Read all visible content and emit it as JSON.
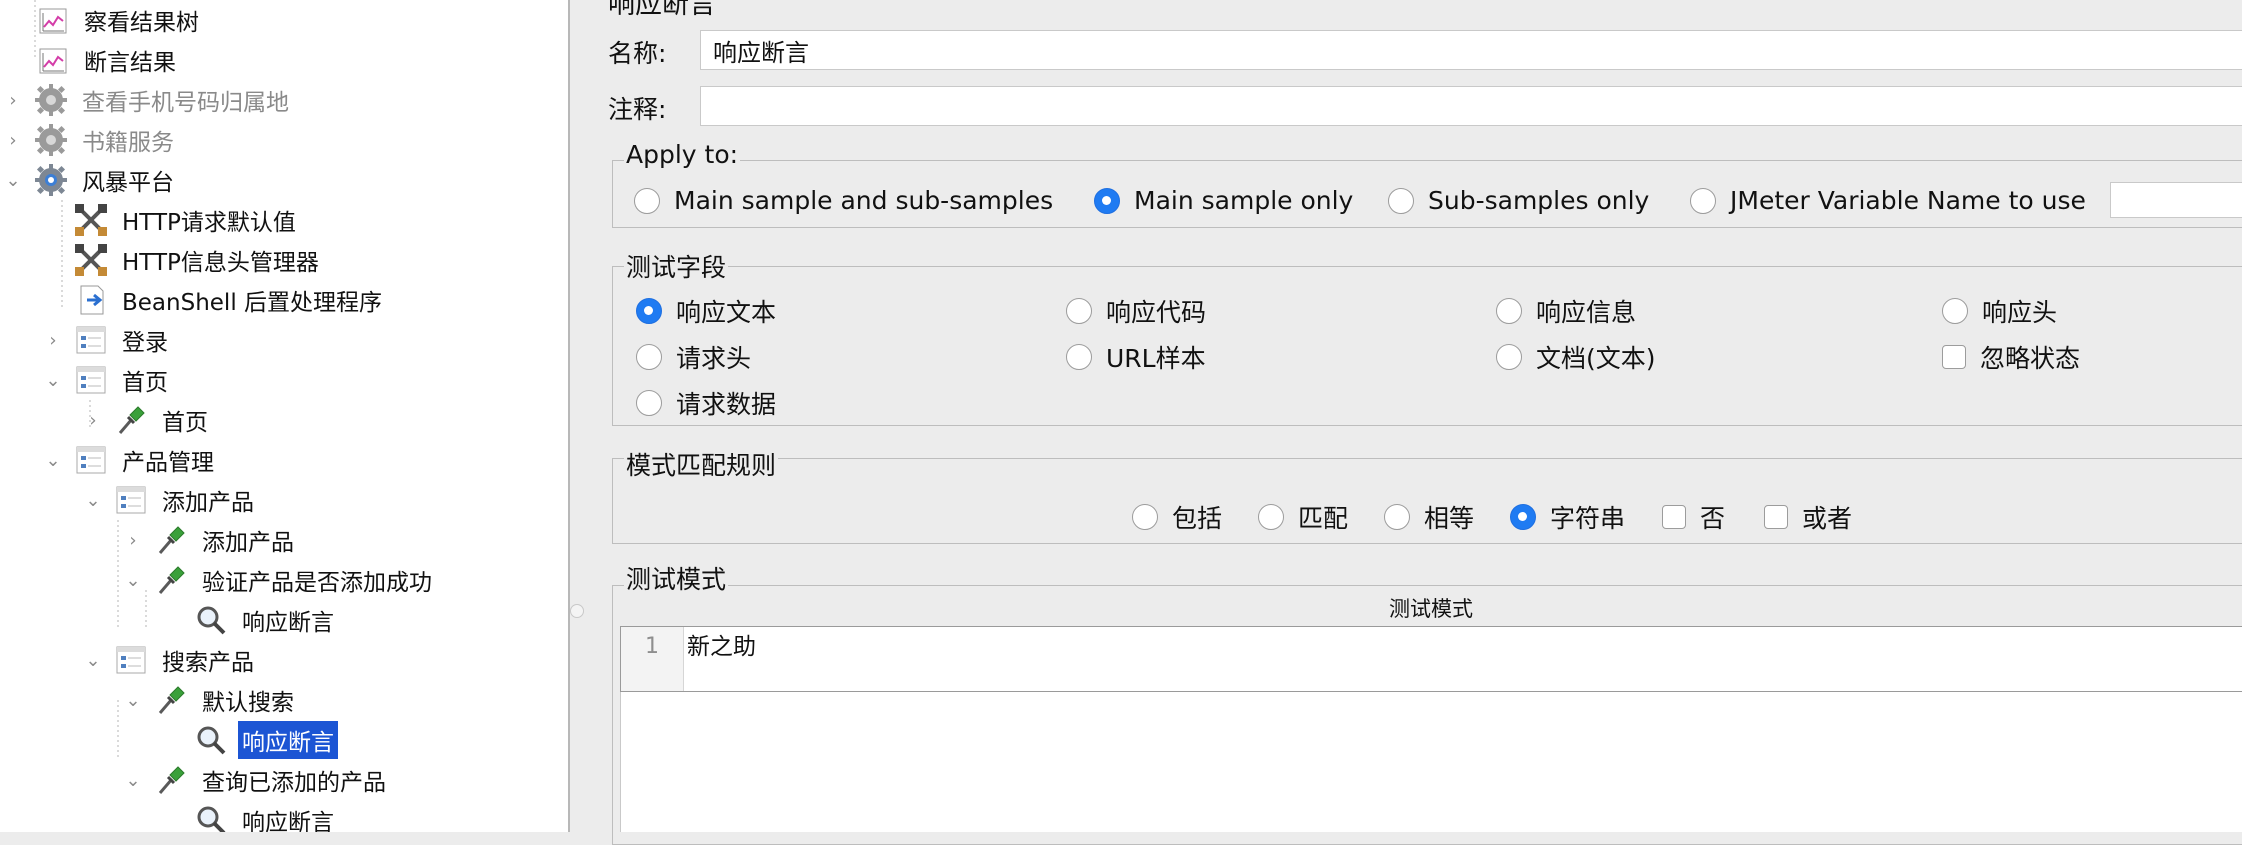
{
  "tree": {
    "items": [
      {
        "label": "察看结果树",
        "icon": "graph-listener-icon",
        "state": "normal"
      },
      {
        "label": "断言结果",
        "icon": "graph-listener-icon",
        "state": "normal"
      },
      {
        "label": "查看手机号码归属地",
        "icon": "gear-icon",
        "state": "disabled"
      },
      {
        "label": "书籍服务",
        "icon": "gear-icon",
        "state": "disabled"
      },
      {
        "label": "风暴平台",
        "icon": "gear-icon",
        "state": "normal"
      },
      {
        "label": "HTTP请求默认值",
        "icon": "tools-icon",
        "state": "normal"
      },
      {
        "label": "HTTP信息头管理器",
        "icon": "tools-icon",
        "state": "normal"
      },
      {
        "label": "BeanShell 后置处理程序",
        "icon": "script-icon",
        "state": "normal"
      },
      {
        "label": "登录",
        "icon": "controller-icon",
        "state": "normal"
      },
      {
        "label": "首页",
        "icon": "controller-icon",
        "state": "normal"
      },
      {
        "label": "首页",
        "icon": "sampler-icon",
        "state": "normal"
      },
      {
        "label": "产品管理",
        "icon": "controller-icon",
        "state": "normal"
      },
      {
        "label": "添加产品",
        "icon": "controller-icon",
        "state": "normal"
      },
      {
        "label": "添加产品",
        "icon": "sampler-icon",
        "state": "normal"
      },
      {
        "label": "验证产品是否添加成功",
        "icon": "sampler-icon",
        "state": "normal"
      },
      {
        "label": "响应断言",
        "icon": "assertion-icon",
        "state": "normal"
      },
      {
        "label": "搜索产品",
        "icon": "controller-icon",
        "state": "normal"
      },
      {
        "label": "默认搜索",
        "icon": "sampler-icon",
        "state": "normal"
      },
      {
        "label": "响应断言",
        "icon": "assertion-icon",
        "state": "selected"
      },
      {
        "label": "查询已添加的产品",
        "icon": "sampler-icon",
        "state": "normal"
      },
      {
        "label": "响应断言",
        "icon": "assertion-icon",
        "state": "normal"
      }
    ]
  },
  "panel": {
    "title": "响应断言",
    "name_label": "名称:",
    "name_value": "响应断言",
    "comment_label": "注释:",
    "comment_value": "",
    "apply_to": {
      "title": "Apply to:",
      "options": [
        "Main sample and sub-samples",
        "Main sample only",
        "Sub-samples only",
        "JMeter Variable Name to use"
      ],
      "selected": "Main sample only",
      "variable_value": ""
    },
    "test_field": {
      "title": "测试字段",
      "options": [
        "响应文本",
        "响应代码",
        "响应信息",
        "响应头",
        "请求头",
        "URL样本",
        "文档(文本)",
        "请求数据"
      ],
      "checkbox": "忽略状态",
      "selected": "响应文本"
    },
    "pattern_rules": {
      "title": "模式匹配规则",
      "radios": [
        "包括",
        "匹配",
        "相等",
        "字符串"
      ],
      "checks": [
        "否",
        "或者"
      ],
      "selected": "字符串"
    },
    "test_patterns": {
      "title": "测试模式",
      "column_header": "测试模式",
      "rows": [
        {
          "line": "1",
          "text": "新之助"
        }
      ]
    }
  },
  "colors": {
    "selection": "#1c55d4",
    "radio_on": "#1f7bf2",
    "background": "#ececec"
  }
}
